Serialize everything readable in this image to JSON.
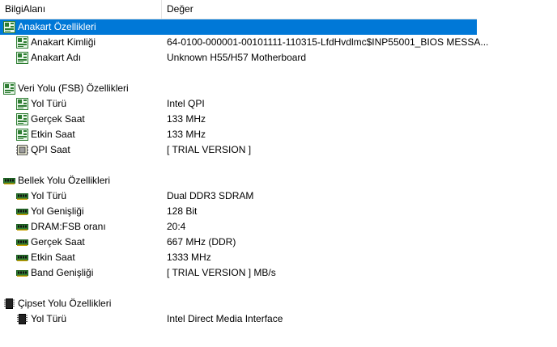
{
  "columns": {
    "field": "BilgiAlanı",
    "value": "Değer"
  },
  "sections": {
    "motherboard": {
      "title": "Anakart Özellikleri",
      "items": [
        {
          "label": "Anakart Kimliği",
          "value": "64-0100-000001-00101111-110315-LfdHvdlmc$INP55001_BIOS MESSA..."
        },
        {
          "label": "Anakart Adı",
          "value": "Unknown H55/H57 Motherboard"
        }
      ]
    },
    "fsb": {
      "title": "Veri Yolu (FSB) Özellikleri",
      "items": [
        {
          "label": "Yol Türü",
          "value": "Intel QPI"
        },
        {
          "label": "Gerçek Saat",
          "value": "133 MHz"
        },
        {
          "label": "Etkin Saat",
          "value": "133 MHz"
        },
        {
          "label": "QPI Saat",
          "value": "[ TRIAL VERSION ]"
        }
      ]
    },
    "memory": {
      "title": "Bellek Yolu Özellikleri",
      "items": [
        {
          "label": "Yol Türü",
          "value": "Dual DDR3 SDRAM"
        },
        {
          "label": "Yol Genişliği",
          "value": "128 Bit"
        },
        {
          "label": "DRAM:FSB oranı",
          "value": "20:4"
        },
        {
          "label": "Gerçek Saat",
          "value": "667 MHz (DDR)"
        },
        {
          "label": "Etkin Saat",
          "value": "1333 MHz"
        },
        {
          "label": "Band Genişliği",
          "value": "[ TRIAL VERSION ] MB/s"
        }
      ]
    },
    "chipset": {
      "title": "Çipset Yolu Özellikleri",
      "items": [
        {
          "label": "Yol Türü",
          "value": "Intel Direct Media Interface"
        }
      ]
    }
  },
  "colors": {
    "selection": "#0078d7",
    "board_green": "#2e7d32",
    "memory_green": "#1b5e20"
  }
}
